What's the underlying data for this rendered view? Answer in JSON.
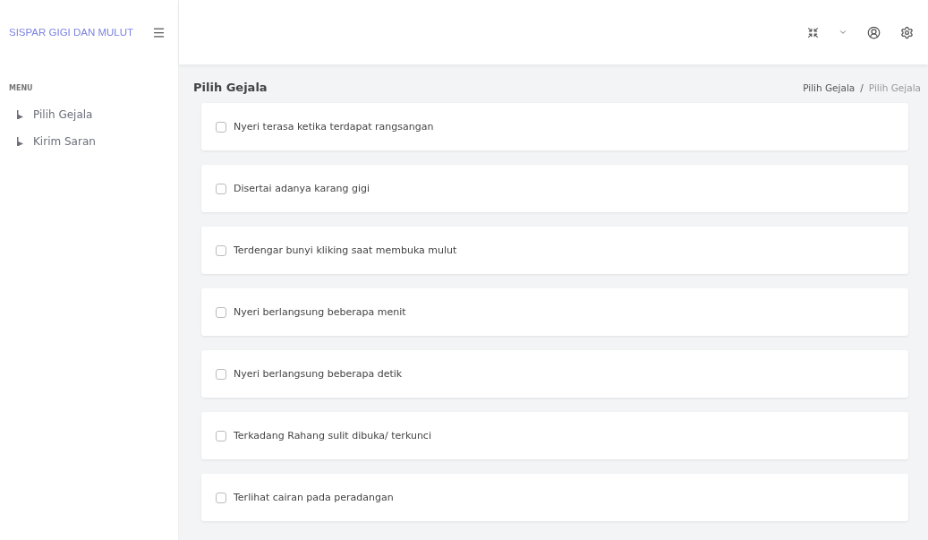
{
  "brand": {
    "title": "SISPAR GIGI DAN MULUT"
  },
  "sidebar": {
    "heading": "MENU",
    "items": [
      {
        "label": "Pilih Gejala"
      },
      {
        "label": "Kirim Saran"
      }
    ]
  },
  "page": {
    "title": "Pilih Gejala",
    "breadcrumb": [
      "Pilih Gejala",
      "/",
      "Pilih Gejala"
    ]
  },
  "symptoms": [
    {
      "label": "Nyeri terasa ketika terdapat rangsangan",
      "checked": false
    },
    {
      "label": "Disertai adanya karang gigi",
      "checked": false
    },
    {
      "label": "Terdengar bunyi kliking saat membuka mulut",
      "checked": false
    },
    {
      "label": "Nyeri berlangsung beberapa menit",
      "checked": false
    },
    {
      "label": "Nyeri berlangsung beberapa detik",
      "checked": false
    },
    {
      "label": "Terkadang Rahang sulit dibuka/ terkunci",
      "checked": false
    },
    {
      "label": "Terlihat cairan pada peradangan",
      "checked": false
    }
  ]
}
